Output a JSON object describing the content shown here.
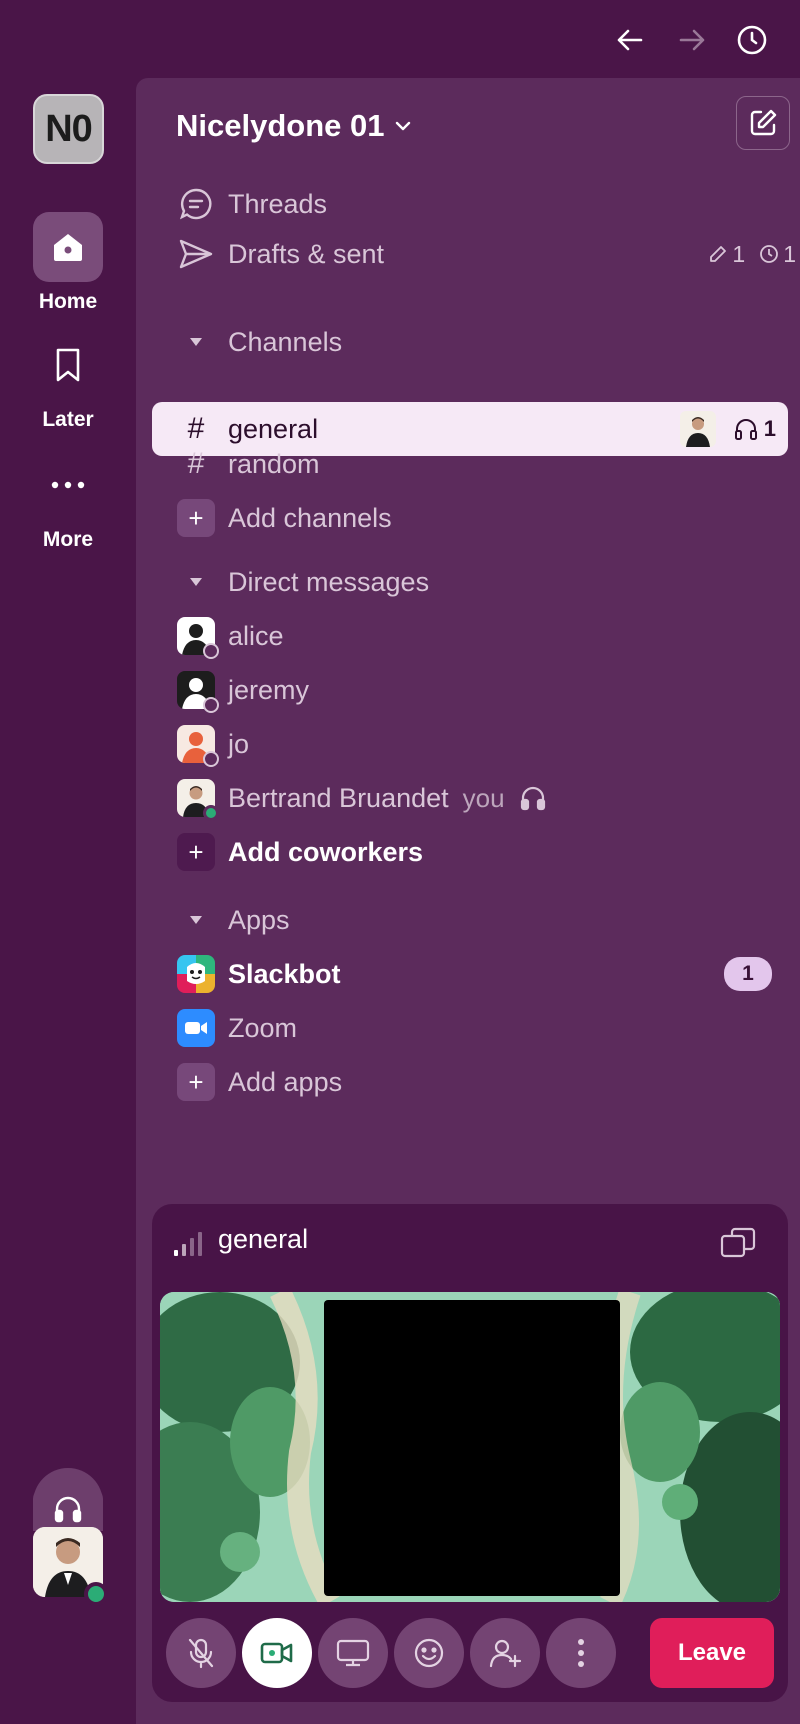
{
  "workspace": {
    "badge": "N0",
    "name": "Nicelydone 01"
  },
  "rail": {
    "home_label": "Home",
    "later_label": "Later",
    "more_label": "More"
  },
  "nav": {
    "threads": "Threads",
    "drafts": "Drafts & sent",
    "drafts_count": "1",
    "scheduled_count": "1"
  },
  "channels": {
    "header": "Channels",
    "items": [
      {
        "name": "general",
        "huddle_count": "1"
      },
      {
        "name": "random"
      }
    ],
    "add_label": "Add channels"
  },
  "dms": {
    "header": "Direct messages",
    "items": [
      {
        "name": "alice"
      },
      {
        "name": "jeremy"
      },
      {
        "name": "jo"
      },
      {
        "name": "Bertrand Bruandet",
        "tag": "you"
      }
    ],
    "add_label": "Add coworkers"
  },
  "apps": {
    "header": "Apps",
    "items": [
      {
        "name": "Slackbot",
        "badge": "1"
      },
      {
        "name": "Zoom"
      }
    ],
    "add_label": "Add apps"
  },
  "huddle": {
    "channel": "general",
    "leave_label": "Leave"
  },
  "colors": {
    "background": "#4a1548",
    "panel": "#5c2b5c",
    "active_row": "#f6e9f6",
    "leave": "#e01e5a",
    "presence_online": "#2bac76"
  }
}
